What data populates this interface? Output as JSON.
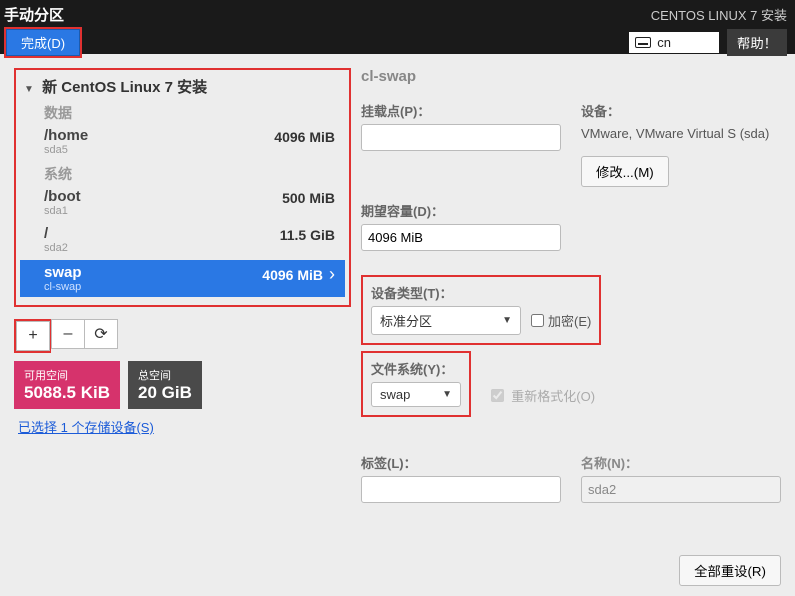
{
  "header": {
    "title": "手动分区",
    "done_button": "完成(D)",
    "installer_title": "CENTOS LINUX 7 安装",
    "locale": "cn",
    "help_button": "帮助！"
  },
  "tree": {
    "title": "新 CentOS Linux 7 安装",
    "cat_data": "数据",
    "cat_system": "系统",
    "items": [
      {
        "mount": "/home",
        "device": "sda5",
        "size": "4096 MiB"
      },
      {
        "mount": "/boot",
        "device": "sda1",
        "size": "500 MiB"
      },
      {
        "mount": "/",
        "device": "sda2",
        "size": "11.5 GiB"
      },
      {
        "mount": "swap",
        "device": "cl-swap",
        "size": "4096 MiB"
      }
    ]
  },
  "toolbar": {
    "add": "+",
    "remove": "–",
    "refresh": "⟳"
  },
  "space": {
    "avail_label": "可用空间",
    "avail_value": "5088.5 KiB",
    "total_label": "总空间",
    "total_value": "20 GiB"
  },
  "devices_link": "已选择 1 个存储设备(S)",
  "panel": {
    "title": "cl-swap",
    "mount_label": "挂载点(P)：",
    "mount_value": "",
    "desired_label": "期望容量(D)：",
    "desired_value": "4096 MiB",
    "devtype_label": "设备类型(T)：",
    "devtype_value": "标准分区",
    "encrypt_label": "加密(E)",
    "fs_label": "文件系统(Y)：",
    "fs_value": "swap",
    "reformat_label": "重新格式化(O)",
    "label_label": "标签(L)：",
    "label_value": "",
    "name_label": "名称(N)：",
    "name_value": "sda2",
    "devices_label": "设备：",
    "devices_text": "VMware, VMware Virtual S (sda)",
    "modify_button": "修改...(M)"
  },
  "footer": {
    "reset_button": "全部重设(R)"
  }
}
